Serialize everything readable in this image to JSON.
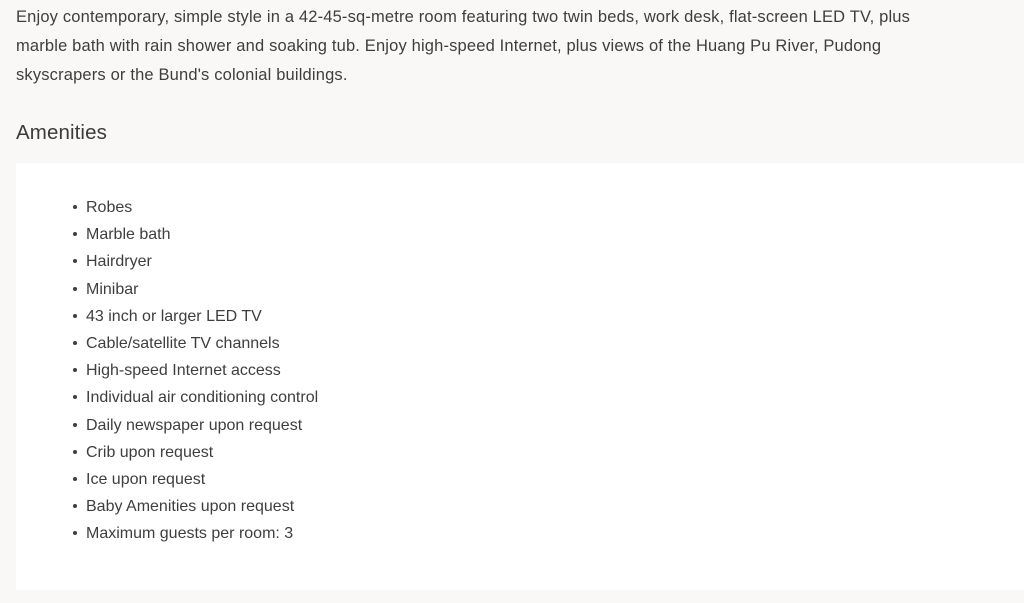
{
  "description": {
    "text": "Enjoy contemporary, simple style in a 42-45-sq-metre room featuring two twin beds, work desk, flat-screen LED TV, plus marble bath with rain shower and soaking tub. Enjoy high-speed Internet, plus views of the Huang Pu River, Pudong skyscrapers or the Bund's colonial buildings."
  },
  "amenities": {
    "heading": "Amenities",
    "items": [
      "Robes",
      "Marble bath",
      "Hairdryer",
      "Minibar",
      "43 inch or larger LED TV",
      "Cable/satellite TV channels",
      "High-speed Internet access",
      "Individual air conditioning control",
      "Daily newspaper upon request",
      "Crib upon request",
      "Ice upon request",
      "Baby Amenities upon request",
      "Maximum guests per room: 3"
    ]
  },
  "colors": {
    "page_background": "#ffffff",
    "section_background": "#f9f8f7",
    "card_background": "#ffffff",
    "text": "#3e3e3e",
    "heading": "#3b3b3b"
  }
}
